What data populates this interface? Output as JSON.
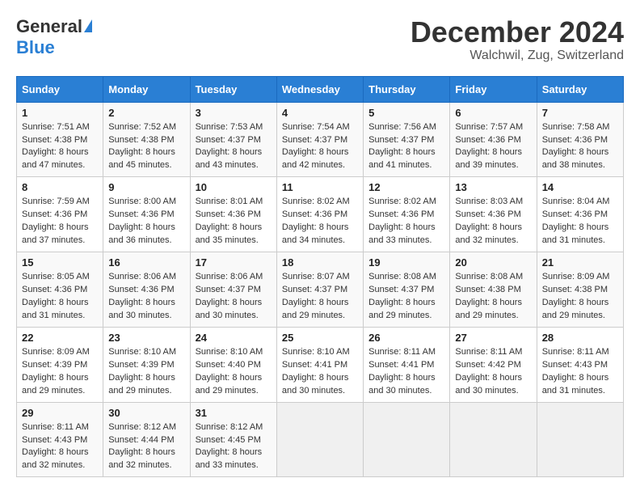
{
  "header": {
    "logo_general": "General",
    "logo_blue": "Blue",
    "month_title": "December 2024",
    "location": "Walchwil, Zug, Switzerland"
  },
  "days_of_week": [
    "Sunday",
    "Monday",
    "Tuesday",
    "Wednesday",
    "Thursday",
    "Friday",
    "Saturday"
  ],
  "weeks": [
    [
      {
        "day": 1,
        "sunrise": "7:51 AM",
        "sunset": "4:38 PM",
        "daylight": "8 hours and 47 minutes."
      },
      {
        "day": 2,
        "sunrise": "7:52 AM",
        "sunset": "4:38 PM",
        "daylight": "8 hours and 45 minutes."
      },
      {
        "day": 3,
        "sunrise": "7:53 AM",
        "sunset": "4:37 PM",
        "daylight": "8 hours and 43 minutes."
      },
      {
        "day": 4,
        "sunrise": "7:54 AM",
        "sunset": "4:37 PM",
        "daylight": "8 hours and 42 minutes."
      },
      {
        "day": 5,
        "sunrise": "7:56 AM",
        "sunset": "4:37 PM",
        "daylight": "8 hours and 41 minutes."
      },
      {
        "day": 6,
        "sunrise": "7:57 AM",
        "sunset": "4:36 PM",
        "daylight": "8 hours and 39 minutes."
      },
      {
        "day": 7,
        "sunrise": "7:58 AM",
        "sunset": "4:36 PM",
        "daylight": "8 hours and 38 minutes."
      }
    ],
    [
      {
        "day": 8,
        "sunrise": "7:59 AM",
        "sunset": "4:36 PM",
        "daylight": "8 hours and 37 minutes."
      },
      {
        "day": 9,
        "sunrise": "8:00 AM",
        "sunset": "4:36 PM",
        "daylight": "8 hours and 36 minutes."
      },
      {
        "day": 10,
        "sunrise": "8:01 AM",
        "sunset": "4:36 PM",
        "daylight": "8 hours and 35 minutes."
      },
      {
        "day": 11,
        "sunrise": "8:02 AM",
        "sunset": "4:36 PM",
        "daylight": "8 hours and 34 minutes."
      },
      {
        "day": 12,
        "sunrise": "8:02 AM",
        "sunset": "4:36 PM",
        "daylight": "8 hours and 33 minutes."
      },
      {
        "day": 13,
        "sunrise": "8:03 AM",
        "sunset": "4:36 PM",
        "daylight": "8 hours and 32 minutes."
      },
      {
        "day": 14,
        "sunrise": "8:04 AM",
        "sunset": "4:36 PM",
        "daylight": "8 hours and 31 minutes."
      }
    ],
    [
      {
        "day": 15,
        "sunrise": "8:05 AM",
        "sunset": "4:36 PM",
        "daylight": "8 hours and 31 minutes."
      },
      {
        "day": 16,
        "sunrise": "8:06 AM",
        "sunset": "4:36 PM",
        "daylight": "8 hours and 30 minutes."
      },
      {
        "day": 17,
        "sunrise": "8:06 AM",
        "sunset": "4:37 PM",
        "daylight": "8 hours and 30 minutes."
      },
      {
        "day": 18,
        "sunrise": "8:07 AM",
        "sunset": "4:37 PM",
        "daylight": "8 hours and 29 minutes."
      },
      {
        "day": 19,
        "sunrise": "8:08 AM",
        "sunset": "4:37 PM",
        "daylight": "8 hours and 29 minutes."
      },
      {
        "day": 20,
        "sunrise": "8:08 AM",
        "sunset": "4:38 PM",
        "daylight": "8 hours and 29 minutes."
      },
      {
        "day": 21,
        "sunrise": "8:09 AM",
        "sunset": "4:38 PM",
        "daylight": "8 hours and 29 minutes."
      }
    ],
    [
      {
        "day": 22,
        "sunrise": "8:09 AM",
        "sunset": "4:39 PM",
        "daylight": "8 hours and 29 minutes."
      },
      {
        "day": 23,
        "sunrise": "8:10 AM",
        "sunset": "4:39 PM",
        "daylight": "8 hours and 29 minutes."
      },
      {
        "day": 24,
        "sunrise": "8:10 AM",
        "sunset": "4:40 PM",
        "daylight": "8 hours and 29 minutes."
      },
      {
        "day": 25,
        "sunrise": "8:10 AM",
        "sunset": "4:41 PM",
        "daylight": "8 hours and 30 minutes."
      },
      {
        "day": 26,
        "sunrise": "8:11 AM",
        "sunset": "4:41 PM",
        "daylight": "8 hours and 30 minutes."
      },
      {
        "day": 27,
        "sunrise": "8:11 AM",
        "sunset": "4:42 PM",
        "daylight": "8 hours and 30 minutes."
      },
      {
        "day": 28,
        "sunrise": "8:11 AM",
        "sunset": "4:43 PM",
        "daylight": "8 hours and 31 minutes."
      }
    ],
    [
      {
        "day": 29,
        "sunrise": "8:11 AM",
        "sunset": "4:43 PM",
        "daylight": "8 hours and 32 minutes."
      },
      {
        "day": 30,
        "sunrise": "8:12 AM",
        "sunset": "4:44 PM",
        "daylight": "8 hours and 32 minutes."
      },
      {
        "day": 31,
        "sunrise": "8:12 AM",
        "sunset": "4:45 PM",
        "daylight": "8 hours and 33 minutes."
      },
      null,
      null,
      null,
      null
    ]
  ]
}
